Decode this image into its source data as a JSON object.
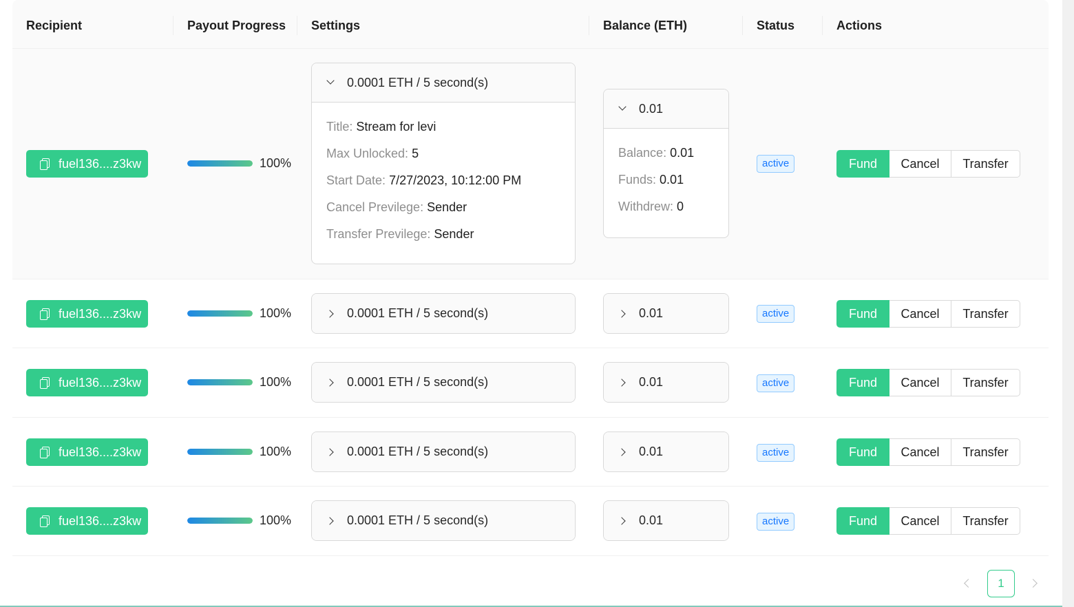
{
  "columns": {
    "recipient": "Recipient",
    "payout_progress": "Payout Progress",
    "settings": "Settings",
    "balance": "Balance (ETH)",
    "status": "Status",
    "actions": "Actions"
  },
  "rows": [
    {
      "recipient": "fuel136....z3kw",
      "progress_percent": 100,
      "progress_text": "100%",
      "settings_summary": "0.0001 ETH / 5 second(s)",
      "settings_expanded": true,
      "settings_details": [
        {
          "key": "Title",
          "value": "Stream for levi"
        },
        {
          "key": "Max Unlocked",
          "value": "5"
        },
        {
          "key": "Start Date",
          "value": "7/27/2023, 10:12:00 PM"
        },
        {
          "key": "Cancel Previlege",
          "value": "Sender"
        },
        {
          "key": "Transfer Previlege",
          "value": "Sender"
        }
      ],
      "balance_summary": "0.01",
      "balance_expanded": true,
      "balance_details": [
        {
          "key": "Balance",
          "value": "0.01"
        },
        {
          "key": "Funds",
          "value": "0.01"
        },
        {
          "key": "Withdrew",
          "value": "0"
        }
      ],
      "status": "active"
    },
    {
      "recipient": "fuel136....z3kw",
      "progress_percent": 100,
      "progress_text": "100%",
      "settings_summary": "0.0001 ETH / 5 second(s)",
      "settings_expanded": false,
      "balance_summary": "0.01",
      "balance_expanded": false,
      "status": "active"
    },
    {
      "recipient": "fuel136....z3kw",
      "progress_percent": 100,
      "progress_text": "100%",
      "settings_summary": "0.0001 ETH / 5 second(s)",
      "settings_expanded": false,
      "balance_summary": "0.01",
      "balance_expanded": false,
      "status": "active"
    },
    {
      "recipient": "fuel136....z3kw",
      "progress_percent": 100,
      "progress_text": "100%",
      "settings_summary": "0.0001 ETH / 5 second(s)",
      "settings_expanded": false,
      "balance_summary": "0.01",
      "balance_expanded": false,
      "status": "active"
    },
    {
      "recipient": "fuel136....z3kw",
      "progress_percent": 100,
      "progress_text": "100%",
      "settings_summary": "0.0001 ETH / 5 second(s)",
      "settings_expanded": false,
      "balance_summary": "0.01",
      "balance_expanded": false,
      "status": "active"
    }
  ],
  "action_labels": {
    "fund": "Fund",
    "cancel": "Cancel",
    "transfer": "Transfer"
  },
  "pagination": {
    "current_page": "1"
  },
  "colors": {
    "accent": "#33cc8c",
    "status_blue": "#1677ff",
    "progress_start": "#1e88e5",
    "progress_end": "#5cc88a"
  },
  "icons": {
    "recipient": "copy-icon",
    "expand": "chevron-right-icon",
    "collapse": "chevron-down-icon",
    "prev": "chevron-left-icon",
    "next": "chevron-right-icon"
  }
}
